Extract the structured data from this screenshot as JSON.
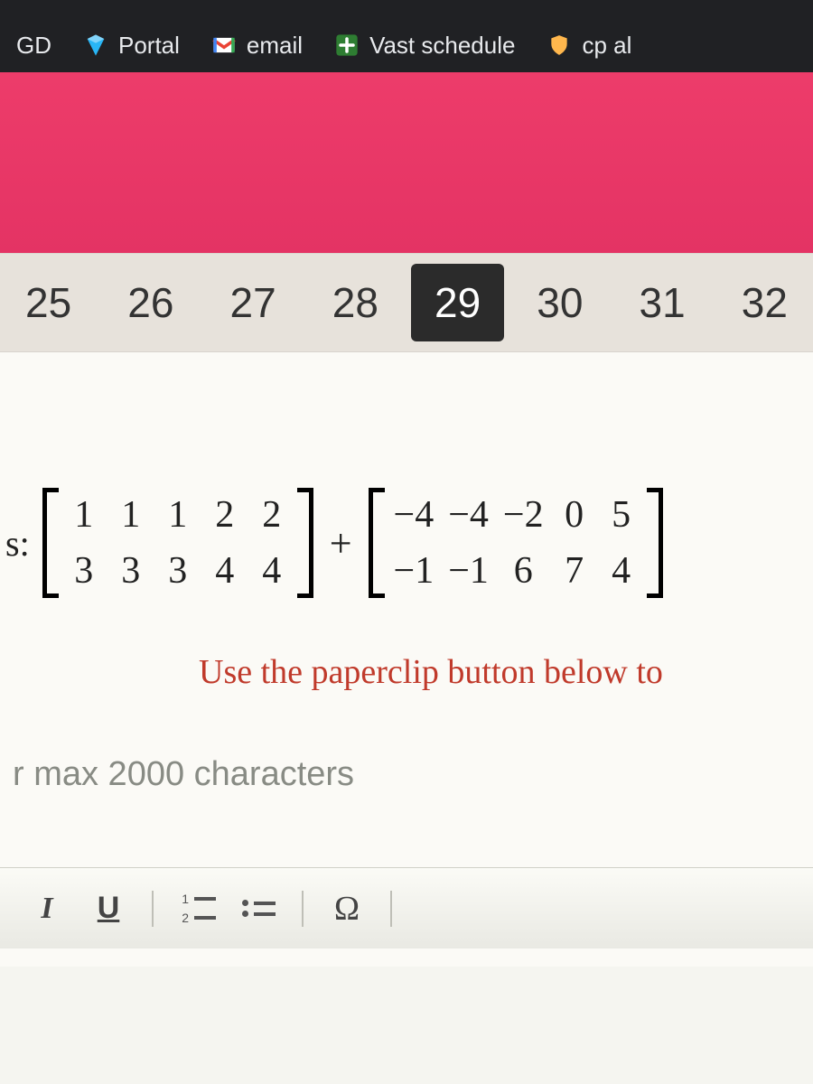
{
  "bookmarks": [
    {
      "label": "GD",
      "icon": null
    },
    {
      "label": "Portal",
      "icon": "diamond"
    },
    {
      "label": "email",
      "icon": "gmail"
    },
    {
      "label": "Vast schedule",
      "icon": "plus-box"
    },
    {
      "label": "cp al",
      "icon": "shield"
    }
  ],
  "numbers": {
    "items": [
      "25",
      "26",
      "27",
      "28",
      "29",
      "30",
      "31",
      "32"
    ],
    "selected_index": 4
  },
  "question": {
    "prefix": "s:",
    "operator": "+",
    "matrix_a": [
      [
        "1",
        "1",
        "1",
        "2",
        "2"
      ],
      [
        "3",
        "3",
        "3",
        "4",
        "4"
      ]
    ],
    "matrix_b": [
      [
        "−4",
        "−4",
        "−2",
        "0",
        "5"
      ],
      [
        "−1",
        "−1",
        "6",
        "7",
        "4"
      ]
    ]
  },
  "instruction_text": "Use the paperclip button below to",
  "answer_placeholder": "r max 2000 characters",
  "toolbar": {
    "italic": "I",
    "underline": "U",
    "omega": "Ω",
    "ol_nums": [
      "1",
      "2"
    ]
  }
}
